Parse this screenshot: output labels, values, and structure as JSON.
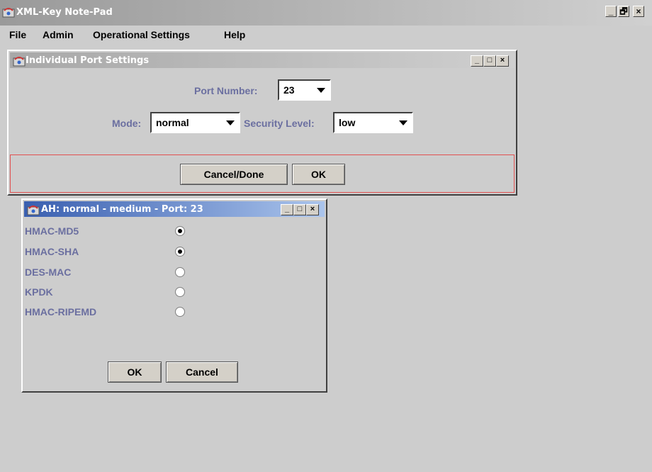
{
  "app": {
    "title": "XML-Key Note-Pad",
    "window_controls": [
      "_",
      "🗗",
      "×"
    ]
  },
  "menu": [
    "File",
    "Admin",
    "Operational Settings",
    "Help"
  ],
  "port_window": {
    "title": "Individual Port Settings",
    "controls": [
      "_",
      "□",
      "×"
    ],
    "port_number_label": "Port Number:",
    "port_number_value": "23",
    "mode_label": "Mode:",
    "mode_value": "normal",
    "security_label": "Security Level:",
    "security_value": "low",
    "cancel_done_label": "Cancel/Done",
    "ok_label": "OK"
  },
  "ah_window": {
    "title": "AH: normal - medium - Port: 23",
    "controls": [
      "_",
      "□",
      "×"
    ],
    "options": [
      {
        "label": "HMAC-MD5",
        "selected": true
      },
      {
        "label": "HMAC-SHA",
        "selected": true
      },
      {
        "label": "DES-MAC",
        "selected": false
      },
      {
        "label": "KPDK",
        "selected": false
      },
      {
        "label": "HMAC-RIPEMD",
        "selected": false
      }
    ],
    "ok_label": "OK",
    "cancel_label": "Cancel"
  },
  "colors": {
    "title_active": "#3a5fb0",
    "title_inactive": "#9a9a9a",
    "label": "#6b6fa0",
    "highlight_border": "#e05050"
  }
}
